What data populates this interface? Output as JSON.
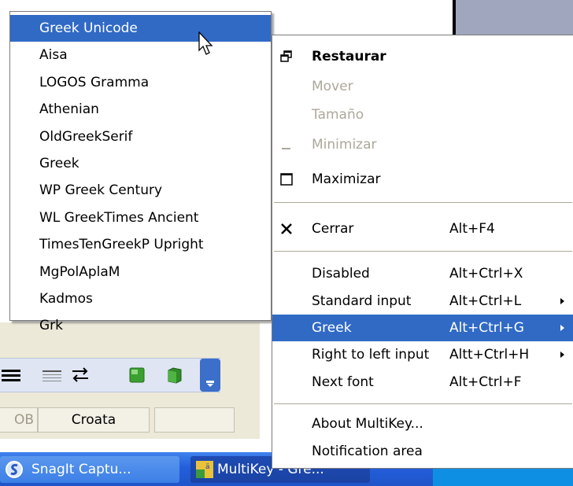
{
  "submenu": {
    "items": [
      {
        "label": "Greek Unicode",
        "selected": true
      },
      {
        "label": "Aisa"
      },
      {
        "label": "LOGOS Gramma"
      },
      {
        "label": "Athenian"
      },
      {
        "label": "OldGreekSerif"
      },
      {
        "label": "Greek"
      },
      {
        "label": "WP Greek Century"
      },
      {
        "label": "WL GreekTimes Ancient"
      },
      {
        "label": "TimesTenGreekP Upright"
      },
      {
        "label": "MgPolAplaM"
      },
      {
        "label": "Kadmos"
      },
      {
        "label": "Grk"
      }
    ]
  },
  "menu": {
    "restore": {
      "label": "Restaurar",
      "icon": "restore-icon"
    },
    "move": {
      "label": "Mover"
    },
    "size": {
      "label": "Tamaño"
    },
    "minimize": {
      "label": "Minimizar",
      "icon": "minimize-icon"
    },
    "maximize": {
      "label": "Maximizar",
      "icon": "maximize-icon"
    },
    "close": {
      "label": "Cerrar",
      "shortcut": "Alt+F4",
      "icon": "close-icon"
    },
    "disabled": {
      "label": "Disabled",
      "shortcut": "Alt+Ctrl+X"
    },
    "standard_input": {
      "label": "Standard input",
      "shortcut": "Alt+Ctrl+L"
    },
    "greek": {
      "label": "Greek",
      "shortcut": "Alt+Ctrl+G"
    },
    "rtl_input": {
      "label": "Right to left input",
      "shortcut": "Altt+Ctrl+H"
    },
    "next_font": {
      "label": "Next font",
      "shortcut": "Alt+Ctrl+F"
    },
    "about": {
      "label": "About MultiKey..."
    },
    "notification": {
      "label": "Notification area"
    }
  },
  "statusbar": {
    "cell1": "OB",
    "cell2": "Croata"
  },
  "taskbar": {
    "snagit": "SnagIt Captu...",
    "multikey": "MultiKey - Gre..."
  },
  "colors": {
    "highlight": "#316ac5",
    "taskbar": "#245edb",
    "disabled_text": "#aca899"
  }
}
